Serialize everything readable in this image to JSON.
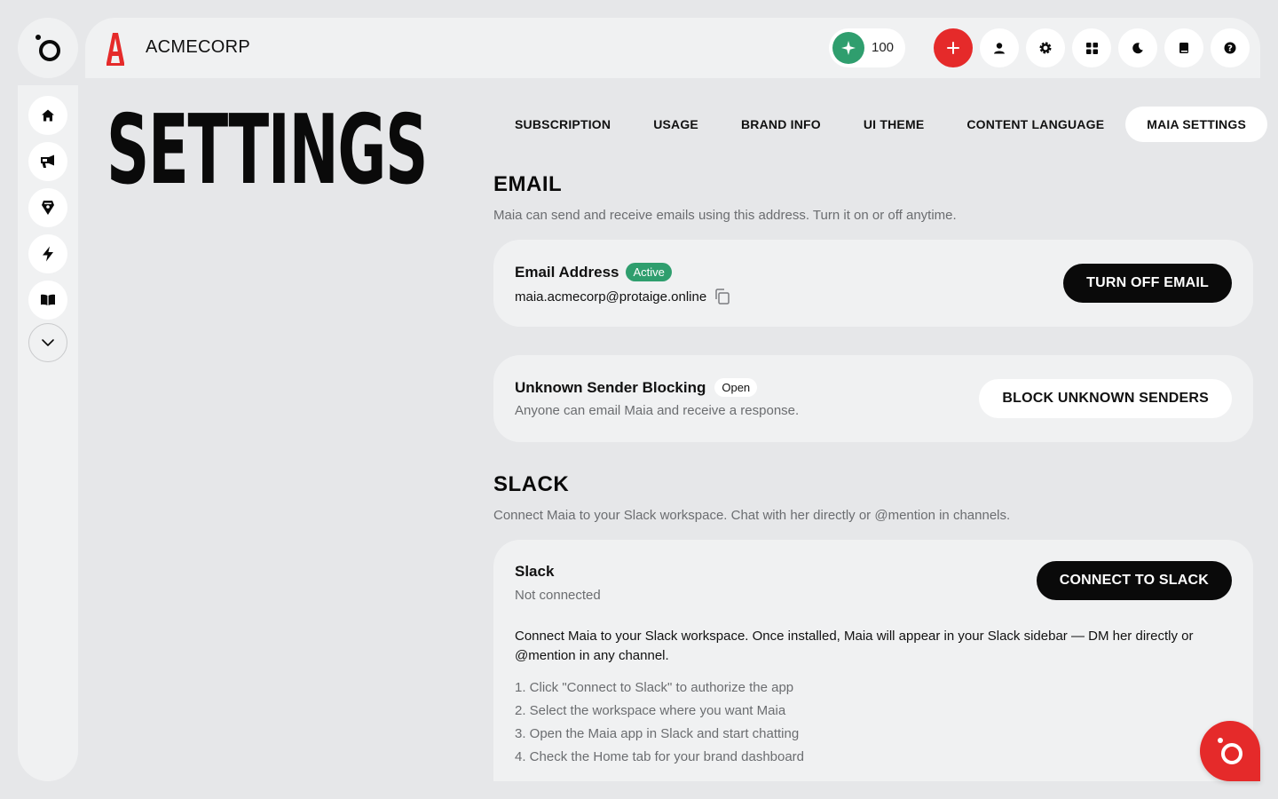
{
  "brand": {
    "name": "ACMECORP",
    "logo_letter": "A"
  },
  "credits": {
    "value": "100",
    "icon": "sparkle-icon"
  },
  "toolbar": {
    "buttons": [
      "plus-icon",
      "user-icon",
      "gear-icon",
      "grid-icon",
      "moon-icon",
      "book-icon",
      "help-icon"
    ]
  },
  "sidebar": {
    "items": [
      "home-icon",
      "megaphone-icon",
      "pen-nib-icon",
      "lightning-icon",
      "open-book-icon",
      "chevron-down-icon"
    ]
  },
  "page": {
    "title": "SETTINGS"
  },
  "tabs": [
    {
      "label": "SUBSCRIPTION",
      "active": false
    },
    {
      "label": "USAGE",
      "active": false
    },
    {
      "label": "BRAND INFO",
      "active": false
    },
    {
      "label": "UI THEME",
      "active": false
    },
    {
      "label": "CONTENT LANGUAGE",
      "active": false
    },
    {
      "label": "MAIA SETTINGS",
      "active": true
    }
  ],
  "email": {
    "title": "EMAIL",
    "description": "Maia can send and receive emails using this address. Turn it on or off anytime.",
    "address_label": "Email Address",
    "status_badge": "Active",
    "address": "maia.acmecorp@protaige.online",
    "toggle_button": "TURN OFF EMAIL",
    "blocking_label": "Unknown Sender Blocking",
    "blocking_badge": "Open",
    "blocking_desc": "Anyone can email Maia and receive a response.",
    "blocking_button": "BLOCK UNKNOWN SENDERS"
  },
  "slack": {
    "title": "SLACK",
    "description": "Connect Maia to your Slack workspace. Chat with her directly or @mention in channels.",
    "card_label": "Slack",
    "status": "Not connected",
    "connect_button": "CONNECT TO SLACK",
    "body": "Connect Maia to your Slack workspace. Once installed, Maia will appear in your Slack sidebar — DM her directly or @mention in any channel.",
    "steps": [
      "1. Click \"Connect to Slack\" to authorize the app",
      "2. Select the workspace where you want Maia",
      "3. Open the Maia app in Slack and start chatting",
      "4. Check the Home tab for your brand dashboard"
    ]
  },
  "colors": {
    "accent_red": "#e52a2a",
    "active_green": "#2f9e6e",
    "background": "#e6e7e9",
    "panel": "#f0f1f2"
  }
}
